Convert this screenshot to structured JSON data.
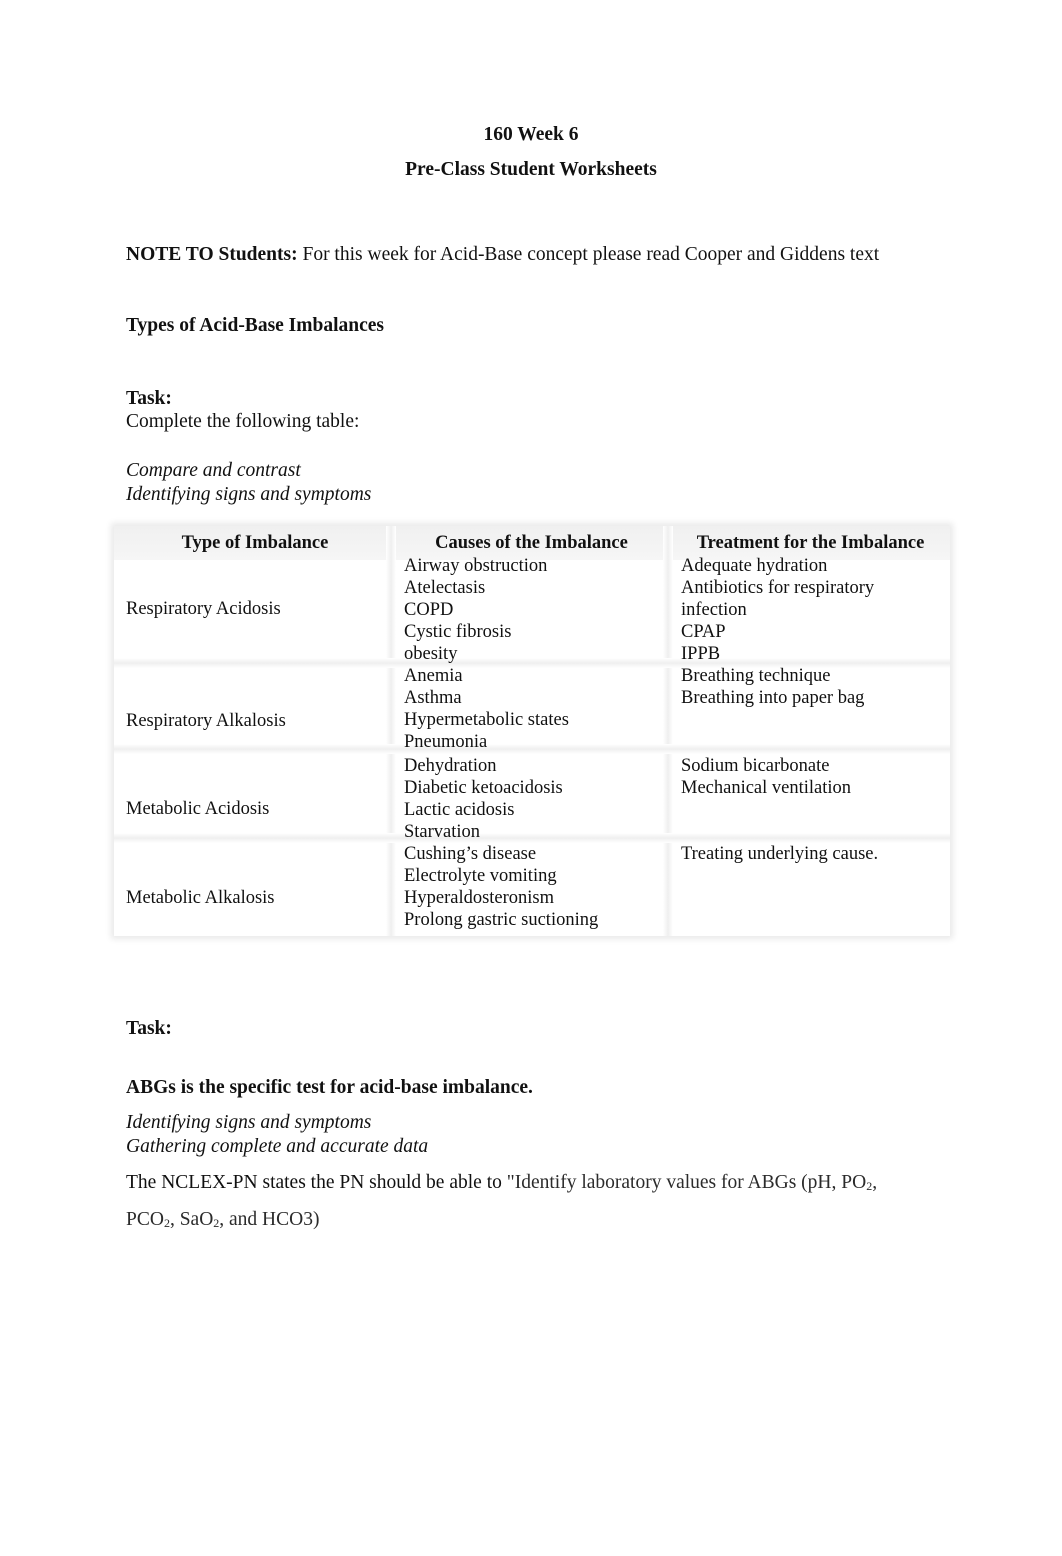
{
  "header": {
    "title": "160 Week 6",
    "subtitle": "Pre-Class Student Worksheets"
  },
  "note": {
    "label": "NOTE TO Students:",
    "text": " For this week for Acid-Base concept please read Cooper and Giddens text"
  },
  "section1": {
    "heading": "Types of Acid-Base Imbalances",
    "task_label": "Task:",
    "instruction": "Complete the following table:",
    "objectives": [
      "Compare and contrast",
      "Identifying signs and symptoms"
    ]
  },
  "table": {
    "columns": [
      "Type of Imbalance",
      "Causes of the Imbalance",
      "Treatment for the Imbalance"
    ],
    "rows": [
      {
        "type": "Respiratory Acidosis",
        "causes": [
          "Airway obstruction",
          "Atelectasis",
          "COPD",
          "Cystic fibrosis",
          "obesity"
        ],
        "treatments": [
          "Adequate hydration",
          "Antibiotics for respiratory",
          "infection",
          "CPAP",
          "IPPB"
        ]
      },
      {
        "type": "Respiratory Alkalosis",
        "causes": [
          "Anemia",
          "Asthma",
          "Hypermetabolic states",
          "Pneumonia"
        ],
        "treatments": [
          "Breathing technique",
          "Breathing into paper bag"
        ]
      },
      {
        "type": "Metabolic Acidosis",
        "causes": [
          "Dehydration",
          "Diabetic ketoacidosis",
          "Lactic acidosis",
          "Starvation"
        ],
        "treatments": [
          "Sodium bicarbonate",
          "Mechanical ventilation"
        ]
      },
      {
        "type": "Metabolic Alkalosis",
        "causes": [
          "Cushing’s disease",
          "Electrolyte vomiting",
          "Hyperaldosteronism",
          "Prolong gastric suctioning"
        ],
        "treatments": [
          "Treating underlying cause."
        ]
      }
    ]
  },
  "section2": {
    "task_label": "Task:",
    "heading": "ABGs is the specific test for acid-base imbalance.",
    "objectives": [
      "Identifying signs and symptoms",
      "Gathering complete and accurate data"
    ],
    "nclex_part1": "The NCLEX-PN states the PN should be able to ",
    "nclex_part2": "\"Identify laboratory values for ABGs (pH, PO",
    "nclex_sub1": "2",
    "nclex_part3": ",",
    "line2_a": "PCO",
    "line2_sub1": "2",
    "line2_b": ", SaO",
    "line2_sub2": "2",
    "line2_c": ", and HCO3)"
  }
}
